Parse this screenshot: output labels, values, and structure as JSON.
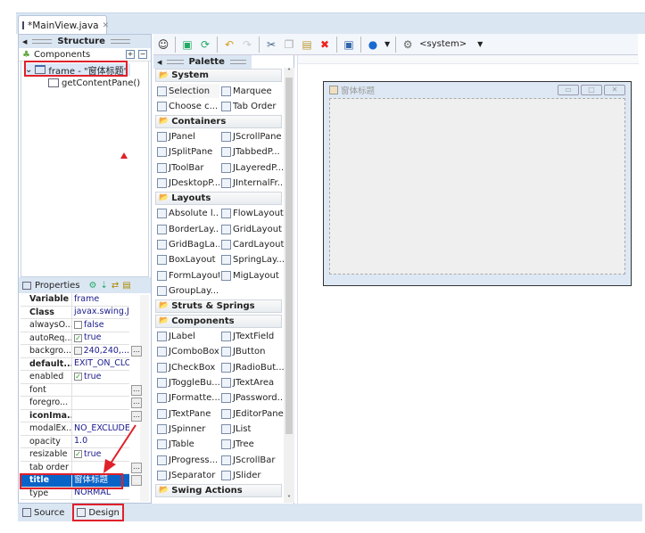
{
  "editor_tab": {
    "title": "*MainView.java",
    "close_icon": "close-icon"
  },
  "structure": {
    "title": "Structure",
    "components_label": "Components",
    "tree": [
      {
        "label": "frame - \"窗体标题\"",
        "level": 0,
        "selected": true
      },
      {
        "label": "getContentPane()",
        "level": 1
      }
    ]
  },
  "properties": {
    "title": "Properties",
    "rows": [
      {
        "name": "Variable",
        "value": "frame",
        "bold": true
      },
      {
        "name": "Class",
        "value": "javax.swing.JFr...",
        "bold": true
      },
      {
        "name": "alwaysO...",
        "value": "false",
        "check": false
      },
      {
        "name": "autoReq...",
        "value": "true",
        "check": true
      },
      {
        "name": "backgro...",
        "value": "240,240,...",
        "color": true,
        "dots": true
      },
      {
        "name": "default...",
        "value": "EXIT_ON_CLOSE",
        "bold": true
      },
      {
        "name": "enabled",
        "value": "true",
        "check": true
      },
      {
        "name": "font",
        "value": "",
        "dots": true
      },
      {
        "name": "foregro...",
        "value": "",
        "dots": true
      },
      {
        "name": "iconIma...",
        "value": "",
        "bold": true,
        "dots": true
      },
      {
        "name": "modalEx...",
        "value": "NO_EXCLUDE"
      },
      {
        "name": "opacity",
        "value": "1.0"
      },
      {
        "name": "resizable",
        "value": "true",
        "check": true
      },
      {
        "name": "tab order",
        "value": "",
        "dots": true
      },
      {
        "name": "title",
        "value": "窗体标题",
        "bold": true,
        "selected": true,
        "dots": true
      },
      {
        "name": "type",
        "value": "NORMAL"
      }
    ]
  },
  "toolbar": {
    "system_label": "<system>"
  },
  "palette": {
    "title": "Palette",
    "sections": [
      {
        "name": "System",
        "items": [
          "Selection",
          "Marquee",
          "Choose c...",
          "Tab Order"
        ]
      },
      {
        "name": "Containers",
        "items": [
          "JPanel",
          "JScrollPane",
          "JSplitPane",
          "JTabbedP...",
          "JToolBar",
          "JLayeredP...",
          "JDesktopP...",
          "JInternalFr..."
        ]
      },
      {
        "name": "Layouts",
        "items": [
          "Absolute l...",
          "FlowLayout",
          "BorderLay...",
          "GridLayout",
          "GridBagLa...",
          "CardLayout",
          "BoxLayout",
          "SpringLay...",
          "FormLayout",
          "MigLayout",
          "GroupLay..."
        ]
      },
      {
        "name": "Struts & Springs",
        "items": []
      },
      {
        "name": "Components",
        "items": [
          "JLabel",
          "JTextField",
          "JComboBox",
          "JButton",
          "JCheckBox",
          "JRadioBut...",
          "JToggleBu...",
          "JTextArea",
          "JFormatte...",
          "JPassword...",
          "JTextPane",
          "JEditorPane",
          "JSpinner",
          "JList",
          "JTable",
          "JTree",
          "JProgress...",
          "JScrollBar",
          "JSeparator",
          "JSlider"
        ]
      },
      {
        "name": "Swing Actions",
        "items": []
      }
    ]
  },
  "design": {
    "frame_title": "窗体标题"
  },
  "bottom_tabs": [
    {
      "label": "Source"
    },
    {
      "label": "Design",
      "active": true
    }
  ],
  "colors": {
    "highlight": "#e0202a",
    "selection": "#0a64c8"
  }
}
